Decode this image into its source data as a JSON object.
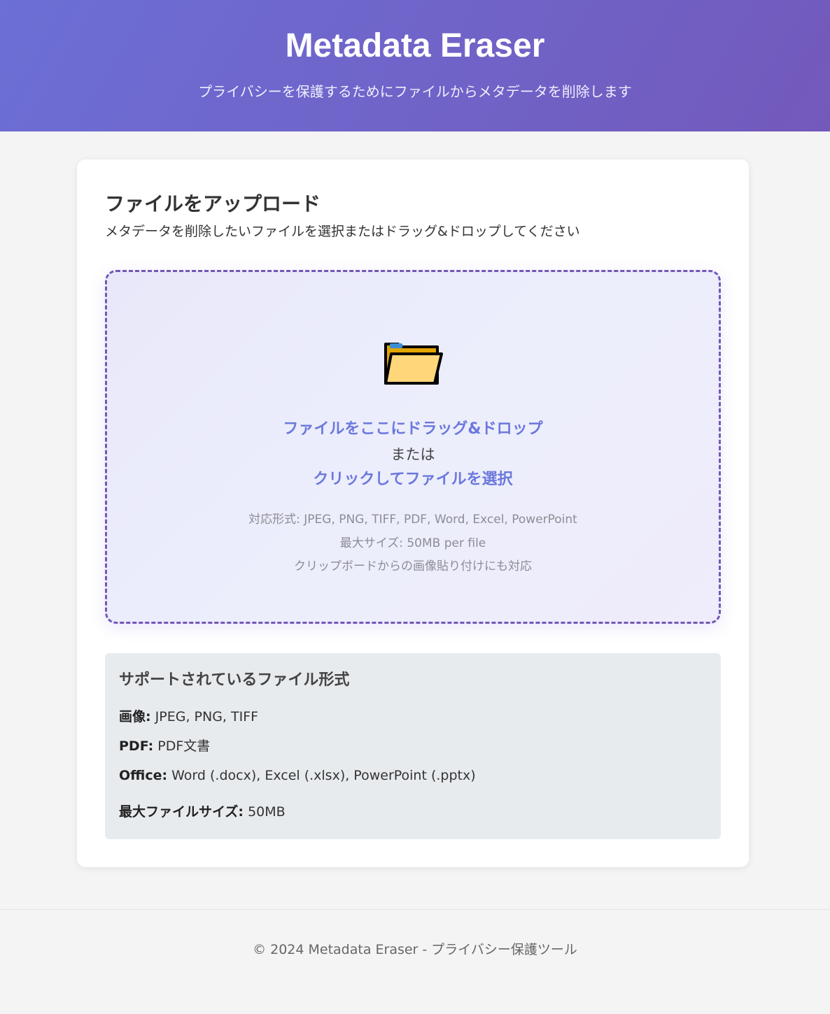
{
  "header": {
    "title": "Metadata Eraser",
    "subtitle": "プライバシーを保護するためにファイルからメタデータを削除します"
  },
  "upload": {
    "heading": "ファイルをアップロード",
    "description": "メタデータを削除したいファイルを選択またはドラッグ&ドロップしてください",
    "dropzone": {
      "icon": "folder-icon",
      "drag_text": "ファイルをここにドラッグ&ドロップ",
      "or_text": "または",
      "click_text": "クリックしてファイルを選択",
      "formats_text": "対応形式: JPEG, PNG, TIFF, PDF, Word, Excel, PowerPoint",
      "max_size_text": "最大サイズ: 50MB per file",
      "clipboard_text": "クリップボードからの画像貼り付けにも対応"
    }
  },
  "supported": {
    "heading": "サポートされているファイル形式",
    "items": [
      {
        "label": "画像:",
        "value": " JPEG, PNG, TIFF"
      },
      {
        "label": "PDF:",
        "value": " PDF文書"
      },
      {
        "label": "Office:",
        "value": " Word (.docx), Excel (.xlsx), PowerPoint (.pptx)"
      }
    ],
    "max_size": {
      "label": "最大ファイルサイズ:",
      "value": " 50MB"
    }
  },
  "footer": {
    "text": "© 2024 Metadata Eraser - プライバシー保護ツール"
  },
  "colors": {
    "header_gradient_start": "#6c6fd6",
    "header_gradient_end": "#7359bb",
    "accent": "#6c78dd",
    "dropzone_border": "#7358b6"
  }
}
